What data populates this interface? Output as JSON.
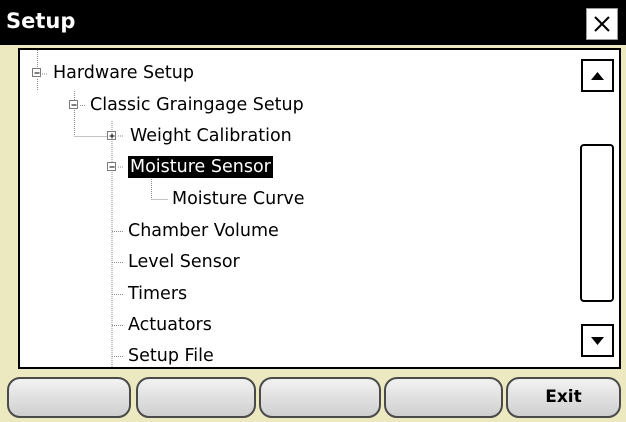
{
  "window": {
    "title": "Setup",
    "close_symbol": "✕"
  },
  "tree": {
    "nodes": [
      {
        "label": "Hardware Setup",
        "expander": "minus"
      },
      {
        "label": "Classic Graingage Setup",
        "expander": "minus"
      },
      {
        "label": "Weight Calibration",
        "expander": "plus"
      },
      {
        "label": "Moisture Sensor",
        "expander": "minus",
        "selected": true
      },
      {
        "label": "Moisture Curve"
      },
      {
        "label": "Chamber Volume"
      },
      {
        "label": "Level Sensor"
      },
      {
        "label": "Timers"
      },
      {
        "label": "Actuators"
      },
      {
        "label": "Setup File"
      }
    ]
  },
  "footer": {
    "buttons": [
      "",
      "",
      "",
      "",
      "Exit"
    ]
  },
  "colors": {
    "titlebar": "#000000",
    "panel": "#ece9c0",
    "selection": "#000000"
  }
}
